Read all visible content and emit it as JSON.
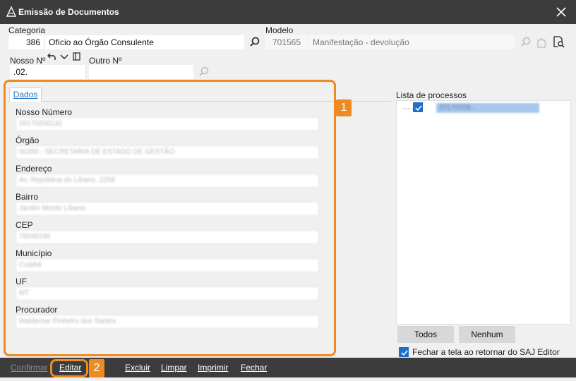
{
  "window": {
    "title": "Emissão de Documentos"
  },
  "header": {
    "categoria_label": "Categoria",
    "categoria_code": "386",
    "categoria_value": "Ofício ao Órgão Consulente",
    "modelo_label": "Modelo",
    "modelo_code": "701565",
    "modelo_value": "Manifestação - devolução",
    "nosso_label": "Nosso Nº",
    "nosso_value": ".02.",
    "outro_label": "Outro Nº",
    "outro_value": ""
  },
  "tabs": [
    {
      "label": "Dados"
    }
  ],
  "form": {
    "fields": [
      {
        "label": "Nosso Número",
        "value": "20170200132"
      },
      {
        "label": "Órgão",
        "value": "00285 - SECRETARIA DE ESTADO DE GESTÃO"
      },
      {
        "label": "Endereço",
        "value": "Av. República do Líbano, 2258"
      },
      {
        "label": "Bairro",
        "value": "Jardim Monte Líbano"
      },
      {
        "label": "CEP",
        "value": "78048196"
      },
      {
        "label": "Município",
        "value": "Cuiabá"
      },
      {
        "label": "UF",
        "value": "MT"
      },
      {
        "label": "Procurador",
        "value": "Waldemar Pinheiro dos Santos"
      }
    ]
  },
  "processos": {
    "label": "Lista de processos",
    "items": [
      {
        "value": "20170208...",
        "checked": true
      }
    ],
    "todos_label": "Todos",
    "nenhum_label": "Nenhum",
    "fechar_label": "Fechar a tela ao retornar do SAJ Editor"
  },
  "annotations": {
    "badge1": "1",
    "badge2": "2"
  },
  "bottom": {
    "confirmar": "Confirmar",
    "editar": "Editar",
    "excluir": "Excluir",
    "limpar": "Limpar",
    "imprimir": "Imprimir",
    "fechar": "Fechar"
  },
  "colors": {
    "accent": "#1e6fc8",
    "annotation": "#ee8a22",
    "titlebar": "#3c3c3c"
  }
}
